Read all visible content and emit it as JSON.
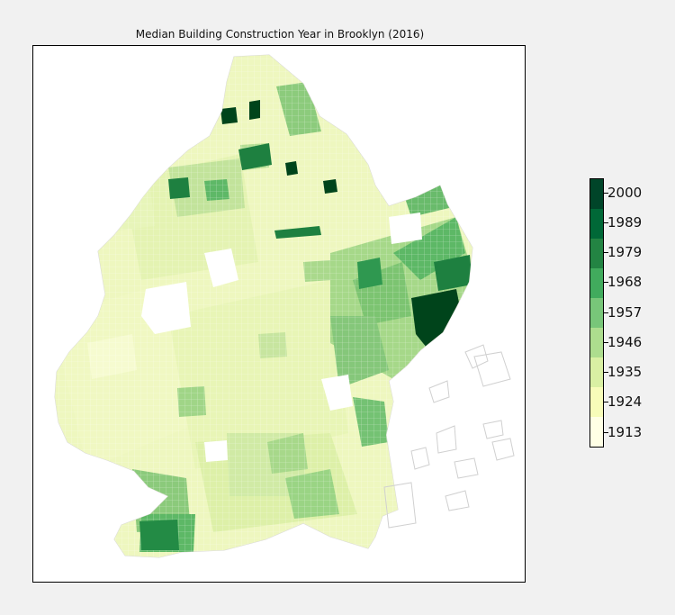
{
  "chart": {
    "title": "Median Building Construction Year in Brooklyn (2016)"
  },
  "legend": {
    "ticks": [
      "2000",
      "1989",
      "1979",
      "1968",
      "1957",
      "1946",
      "1935",
      "1924",
      "1913"
    ],
    "colors": [
      "#00441b",
      "#006d2c",
      "#238b45",
      "#41ab5d",
      "#74c476",
      "#a1d99b",
      "#c7e9c0",
      "#e5f5e0",
      "#f7fcf5"
    ],
    "scale": [
      "#ffffe5",
      "#f7fcb9",
      "#d9f0a3",
      "#addd8e",
      "#78c679",
      "#41ab5d",
      "#238443",
      "#006837",
      "#004529"
    ]
  },
  "map": {
    "area": "Brooklyn"
  }
}
